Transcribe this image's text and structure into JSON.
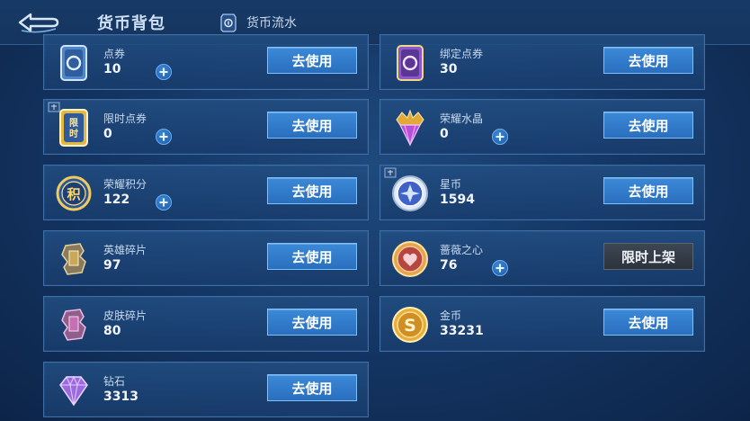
{
  "header": {
    "title": "货币背包",
    "flow_label": "货币流水"
  },
  "currencies": [
    {
      "name": "点券",
      "count": "10",
      "action": "去使用",
      "icon": "coupon-card-icon"
    },
    {
      "name": "绑定点券",
      "count": "30",
      "action": "去使用",
      "icon": "bound-coupon-card-icon"
    },
    {
      "name": "限时点券",
      "count": "0",
      "action": "去使用",
      "icon": "limited-coupon-icon"
    },
    {
      "name": "荣耀水晶",
      "count": "0",
      "action": "去使用",
      "icon": "glory-crystal-icon"
    },
    {
      "name": "荣耀积分",
      "count": "122",
      "action": "去使用",
      "icon": "glory-points-icon"
    },
    {
      "name": "星币",
      "count": "1594",
      "action": "去使用",
      "icon": "star-coin-icon"
    },
    {
      "name": "英雄碎片",
      "count": "97",
      "action": "去使用",
      "icon": "hero-fragment-icon"
    },
    {
      "name": "蔷薇之心",
      "count": "76",
      "action": "限时上架",
      "icon": "rose-heart-icon"
    },
    {
      "name": "皮肤碎片",
      "count": "80",
      "action": "去使用",
      "icon": "skin-fragment-icon"
    },
    {
      "name": "金币",
      "count": "33231",
      "action": "去使用",
      "icon": "gold-coin-icon"
    },
    {
      "name": "钻石",
      "count": "3313",
      "action": "去使用",
      "icon": "diamond-icon"
    }
  ]
}
